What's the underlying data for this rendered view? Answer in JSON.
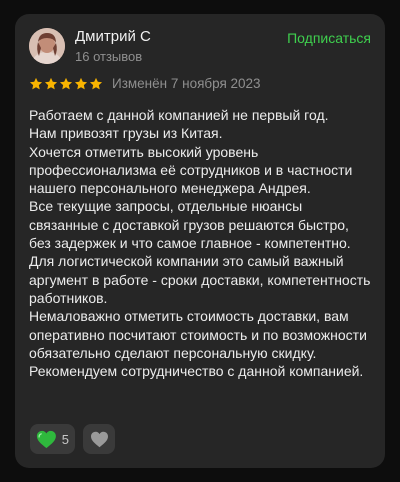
{
  "review": {
    "author": {
      "name": "Дмитрий С",
      "reviews_count": "16 отзывов"
    },
    "subscribe_label": "Подписаться",
    "rating": 5,
    "date": "Изменён 7 ноября 2023",
    "text_lines": [
      "Работаем с данной компанией не первый год.",
      "Нам привозят грузы из Китая.",
      "Хочется отметить высокий уровень профессионализма её сотрудников и в частности нашего персонального менеджера Андрея.",
      "Все текущие запросы, отдельные нюансы связанные с доставкой грузов решаются быстро, без задержек и что самое главное - компетентно.",
      "Для логистической компании это самый важный аргумент в работе - сроки доставки, компетентность работников.",
      "Немаловажно отметить стоимость доставки, вам оперативно посчитают стоимость и по возможности обязательно сделают персональную скидку.",
      "Рекомендуем сотрудничество с данной компанией."
    ],
    "likes": "5"
  },
  "colors": {
    "background": "#0d0d0d",
    "card": "#262626",
    "accent_green": "#3fcf4e",
    "star": "#f7b300",
    "muted_text": "#8f8f8f",
    "like_heart": "#3fcf4e",
    "dislike_heart": "#9a9a9a"
  },
  "icons": {
    "star": "star-icon",
    "like": "green-heart-icon",
    "dislike": "gray-heart-icon"
  }
}
